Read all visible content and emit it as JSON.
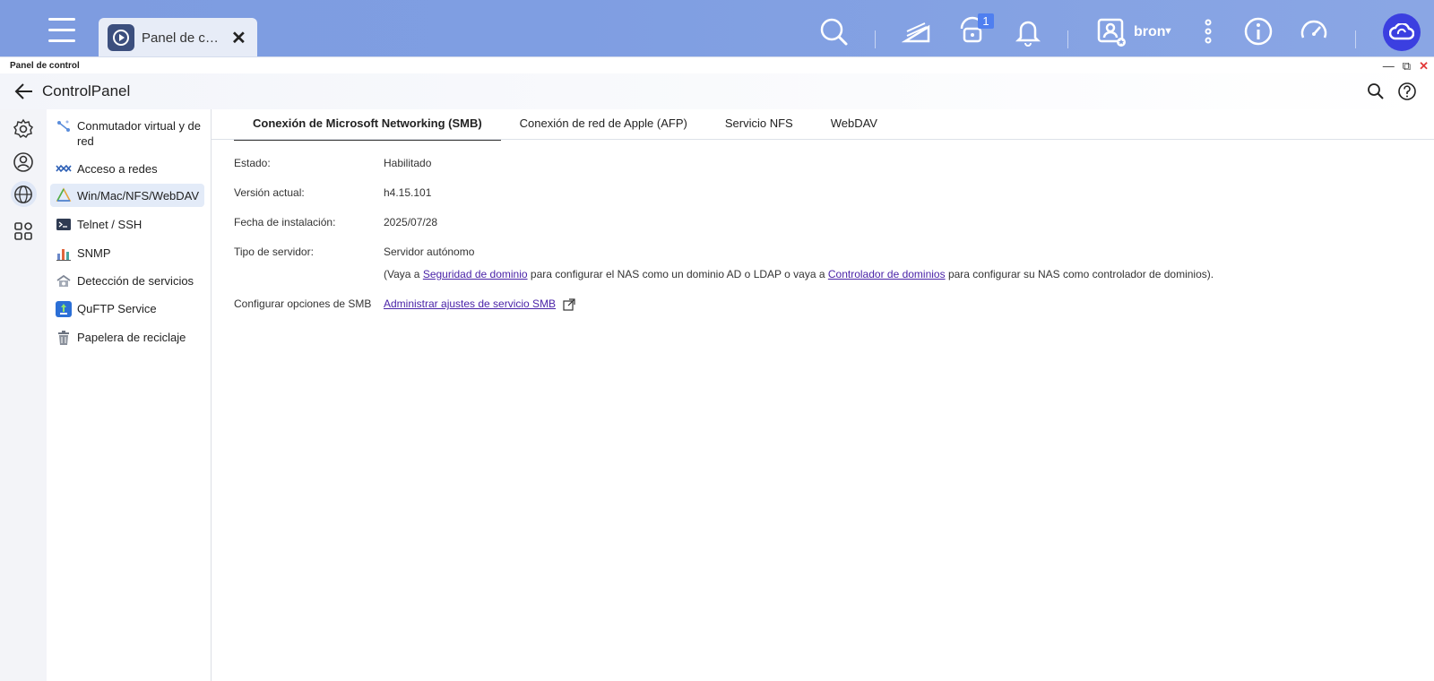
{
  "taskbar": {
    "app_tab_label": "Panel de control",
    "notification_count": "1",
    "user_name": "bron",
    "accent": "#3b3fe0"
  },
  "window": {
    "caption": "Panel de control",
    "title": "ControlPanel",
    "controls": {
      "minimize": "—",
      "restore": "⧉",
      "close": "✕"
    }
  },
  "rail": {
    "items": [
      "gear-icon",
      "user-icon",
      "globe-icon",
      "apps-icon"
    ]
  },
  "sidebar": {
    "items": [
      {
        "label": "Conmutador virtual y de red",
        "icon": "virtual-switch-icon"
      },
      {
        "label": "Acceso a redes",
        "icon": "network-access-icon"
      },
      {
        "label": "Win/Mac/NFS/WebDAV",
        "icon": "win-mac-nfs-icon",
        "active": true
      },
      {
        "label": "Telnet / SSH",
        "icon": "terminal-icon"
      },
      {
        "label": "SNMP",
        "icon": "snmp-icon"
      },
      {
        "label": "Detección de servicios",
        "icon": "service-discovery-icon"
      },
      {
        "label": "QuFTP Service",
        "icon": "quftp-icon"
      },
      {
        "label": "Papelera de reciclaje",
        "icon": "trash-icon"
      }
    ]
  },
  "tabs": [
    {
      "label": "Conexión de Microsoft Networking (SMB)",
      "active": true
    },
    {
      "label": "Conexión de red de Apple (AFP)"
    },
    {
      "label": "Servicio NFS"
    },
    {
      "label": "WebDAV"
    }
  ],
  "details": {
    "estado_label": "Estado:",
    "estado_value": "Habilitado",
    "version_label": "Versión actual:",
    "version_value": "h4.15.101",
    "fecha_label": "Fecha de instalación:",
    "fecha_value": "2025/07/28",
    "tipo_label": "Tipo de servidor:",
    "tipo_value": "Servidor autónomo",
    "note_part1": "(Vaya a ",
    "note_link1": "Seguridad de dominio",
    "note_part2": " para configurar el NAS como un dominio AD o LDAP o vaya a ",
    "note_link2": "Controlador de dominios",
    "note_part3": " para configurar su NAS como controlador de dominios).",
    "smb_label": "Configurar opciones de SMB",
    "smb_link": "Administrar ajustes de servicio SMB"
  }
}
